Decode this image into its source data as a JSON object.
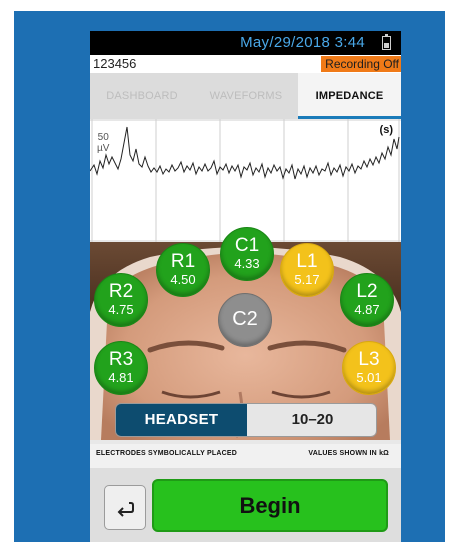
{
  "status_bar": {
    "datetime": "May/29/2018 3:44"
  },
  "info_bar": {
    "patient_id": "123456",
    "recording_status": "Recording Off"
  },
  "tabs": [
    {
      "label": "DASHBOARD",
      "active": false
    },
    {
      "label": "WAVEFORMS",
      "active": false
    },
    {
      "label": "IMPEDANCE",
      "active": true
    }
  ],
  "waveform": {
    "scale_value": "50",
    "scale_unit": "µV",
    "time_unit": "(s)"
  },
  "electrodes": [
    {
      "name": "C1",
      "value": "4.33",
      "status": "green"
    },
    {
      "name": "R1",
      "value": "4.50",
      "status": "green"
    },
    {
      "name": "L1",
      "value": "5.17",
      "status": "yellow"
    },
    {
      "name": "R2",
      "value": "4.75",
      "status": "green"
    },
    {
      "name": "C2",
      "value": "",
      "status": "gray"
    },
    {
      "name": "L2",
      "value": "4.87",
      "status": "green"
    },
    {
      "name": "R3",
      "value": "4.81",
      "status": "green"
    },
    {
      "name": "L3",
      "value": "5.01",
      "status": "yellow"
    }
  ],
  "montage_toggle": {
    "option_a": "HEADSET",
    "option_b": "10–20",
    "selected": "HEADSET"
  },
  "notes": {
    "left": "ELECTRODES SYMBOLICALLY PLACED",
    "right": "VALUES SHOWN IN kΩ"
  },
  "actions": {
    "begin_label": "Begin",
    "back_icon": "return-arrow-icon"
  },
  "colors": {
    "frame_blue": "#1d6fb3",
    "accent_orange": "#f07a17",
    "good_green": "#22a21c",
    "warn_yellow": "#f3c21b",
    "begin_green": "#27c11d"
  }
}
